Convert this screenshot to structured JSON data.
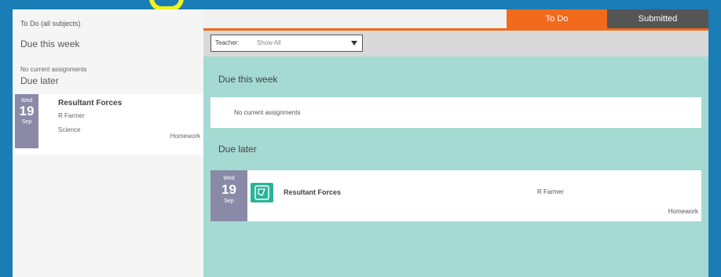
{
  "left_panel": {
    "title": "To Do (all subjects)",
    "due_this_week_heading": "Due this week",
    "no_assignments_text": "No current assignments",
    "due_later_heading": "Due later",
    "card": {
      "day": "Wed",
      "date": "19",
      "month": "Sep",
      "title": "Resultant Forces",
      "teacher": "R Farmer",
      "subject": "Science",
      "type": "Homework"
    }
  },
  "tabs": [
    {
      "label": "To Do",
      "active": true
    },
    {
      "label": "Submitted",
      "active": false
    }
  ],
  "filter": {
    "label": "Teacher:",
    "value": "Show All"
  },
  "main": {
    "due_this_week_heading": "Due this week",
    "no_assignments_text": "No current assignments",
    "due_later_heading": "Due later",
    "card": {
      "day": "Wed",
      "date": "19",
      "month": "Sep",
      "title": "Resultant Forces",
      "teacher": "R Farmer",
      "type": "Homework",
      "icon": "assignment-icon"
    }
  },
  "colors": {
    "accent_orange": "#f26a1b",
    "teal_panel": "#a5dad3",
    "date_block": "#8a8aa8",
    "icon_teal": "#28b49a"
  }
}
